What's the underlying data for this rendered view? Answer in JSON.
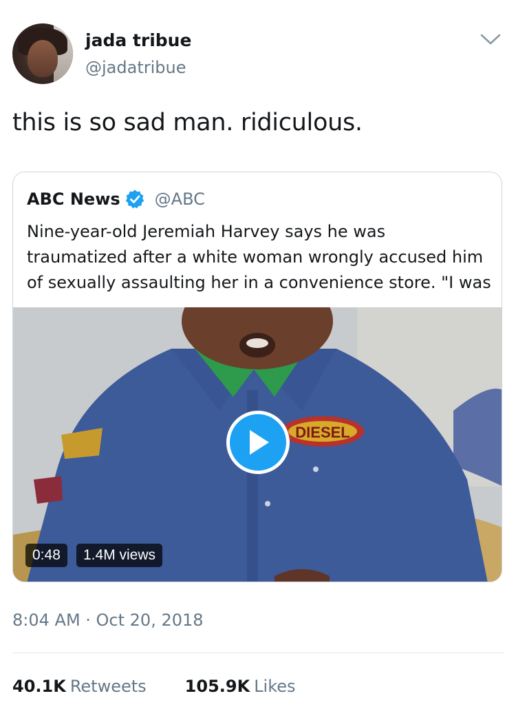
{
  "author": {
    "name": "jada tribue",
    "handle": "@jadatribue",
    "avatar_icon": "profile-photo"
  },
  "tweet": {
    "text": "this is so sad man. ridiculous.",
    "timestamp": "8:04 AM · Oct 20, 2018"
  },
  "quoted_tweet": {
    "name": "ABC News",
    "verified": true,
    "handle": "@ABC",
    "text": "Nine-year-old Jeremiah Harvey says he was\ntraumatized after a white woman wrongly accused him\nof sexually assaulting her in a convenience store. \"I was",
    "video": {
      "duration": "0:48",
      "views": "1.4M views",
      "patch_text": "DIESEL"
    }
  },
  "stats": {
    "retweets_count": "40.1K",
    "retweets_label": "Retweets",
    "likes_count": "105.9K",
    "likes_label": "Likes"
  },
  "colors": {
    "accent": "#1da1f2",
    "secondary_text": "#657786",
    "border": "#ccd6dd"
  }
}
